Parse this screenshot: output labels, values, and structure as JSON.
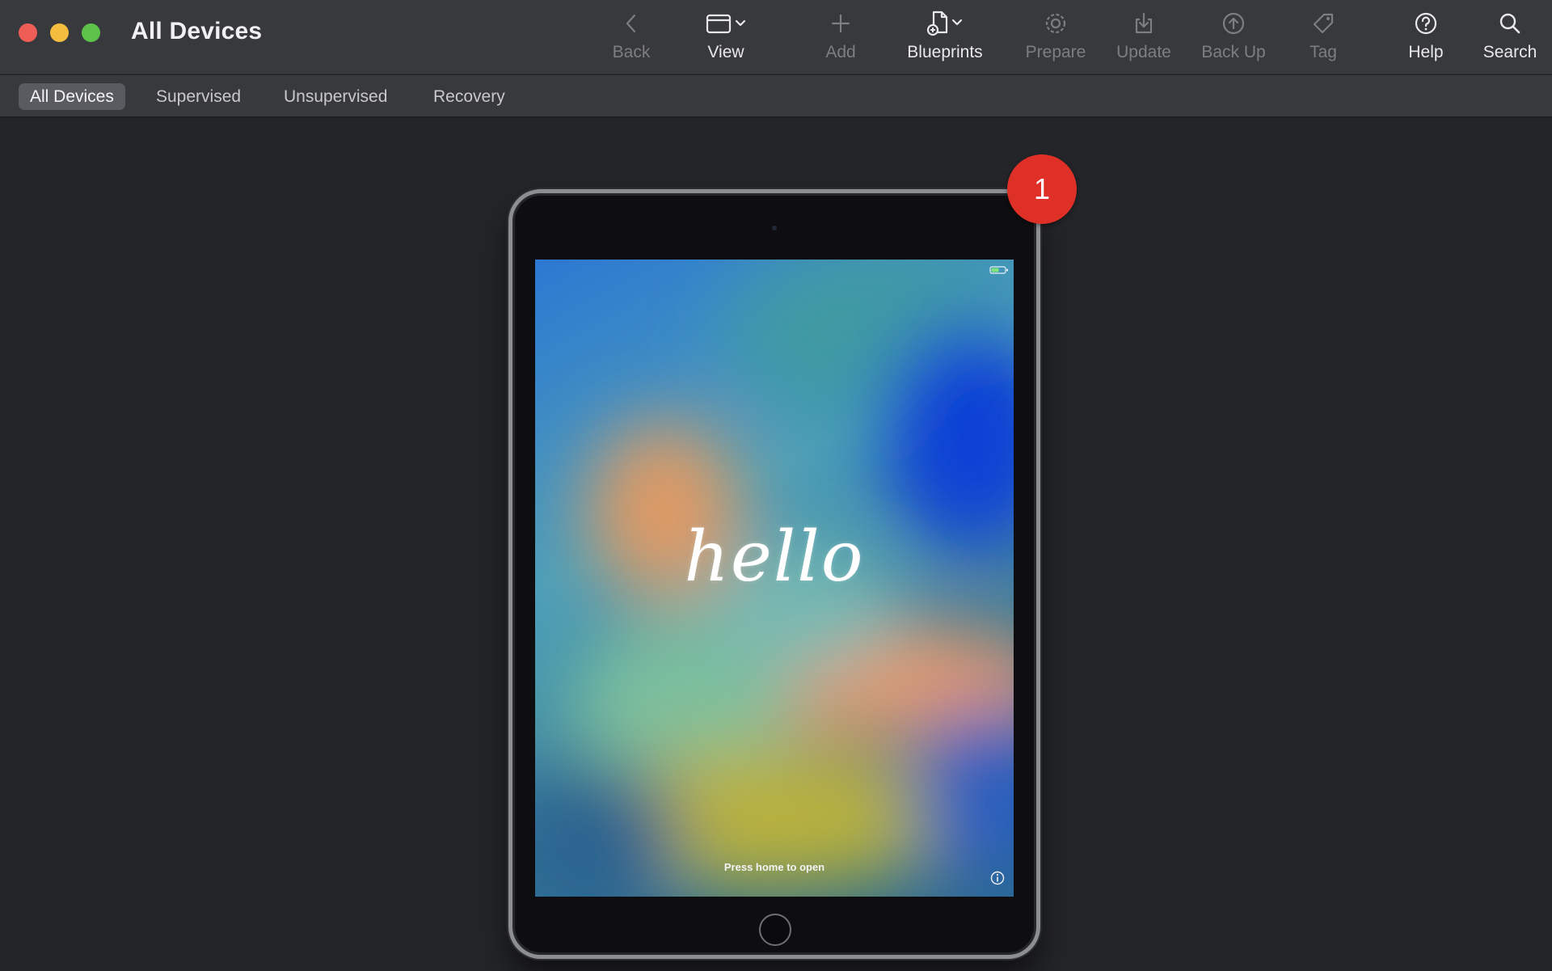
{
  "window": {
    "title": "All Devices",
    "traffic_lights": {
      "close": "#ee5e57",
      "minimize": "#f4bd3f",
      "zoom": "#5ec24a"
    }
  },
  "toolbar": {
    "back": "Back",
    "view": "View",
    "add": "Add",
    "blueprints": "Blueprints",
    "prepare": "Prepare",
    "update": "Update",
    "back_up": "Back Up",
    "tag": "Tag",
    "help": "Help",
    "search": "Search"
  },
  "filters": {
    "items": [
      "All Devices",
      "Supervised",
      "Unsupervised",
      "Recovery"
    ],
    "selected": "All Devices"
  },
  "device": {
    "type": "iPad",
    "screen_greeting": "hello",
    "screen_hint": "Press home to open",
    "badge_count": "1",
    "badge_color": "#df3027"
  }
}
